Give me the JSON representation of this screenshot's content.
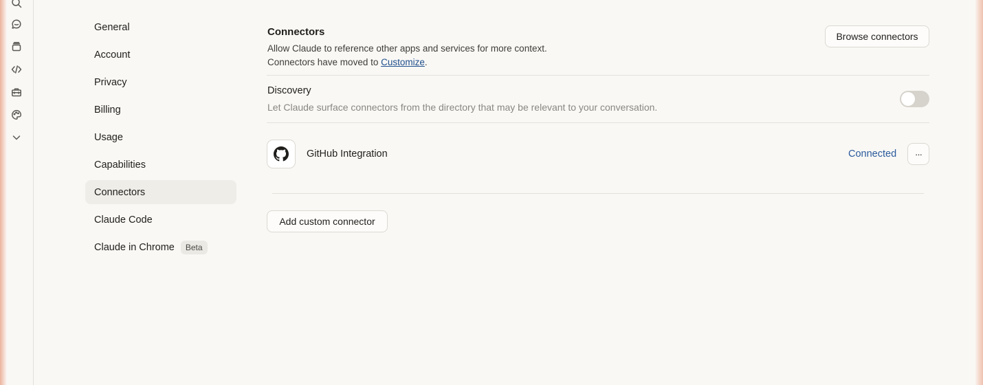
{
  "nav": {
    "items": [
      {
        "label": "General"
      },
      {
        "label": "Account"
      },
      {
        "label": "Privacy"
      },
      {
        "label": "Billing"
      },
      {
        "label": "Usage"
      },
      {
        "label": "Capabilities"
      },
      {
        "label": "Connectors",
        "active": true
      },
      {
        "label": "Claude Code"
      },
      {
        "label": "Claude in Chrome",
        "badge": "Beta"
      }
    ]
  },
  "rail_icons": [
    "search-icon",
    "chat-icon",
    "projects-icon",
    "code-icon",
    "toolbox-icon",
    "palette-icon",
    "chevron-down-icon"
  ],
  "connectors": {
    "title": "Connectors",
    "description": "Allow Claude to reference other apps and services for more context.",
    "moved_prefix": "Connectors have moved to ",
    "moved_link": "Customize",
    "moved_suffix": ".",
    "browse_label": "Browse connectors"
  },
  "discovery": {
    "title": "Discovery",
    "description": "Let Claude surface connectors from the directory that may be relevant to your conversation.",
    "enabled": false
  },
  "integrations": [
    {
      "icon": "github-icon",
      "name": "GitHub Integration",
      "status": "Connected",
      "more_label": "···"
    }
  ],
  "add_custom_label": "Add custom connector",
  "colors": {
    "link": "#1f4e8c",
    "status": "#2a5a9c",
    "active_nav": "#efede8"
  }
}
